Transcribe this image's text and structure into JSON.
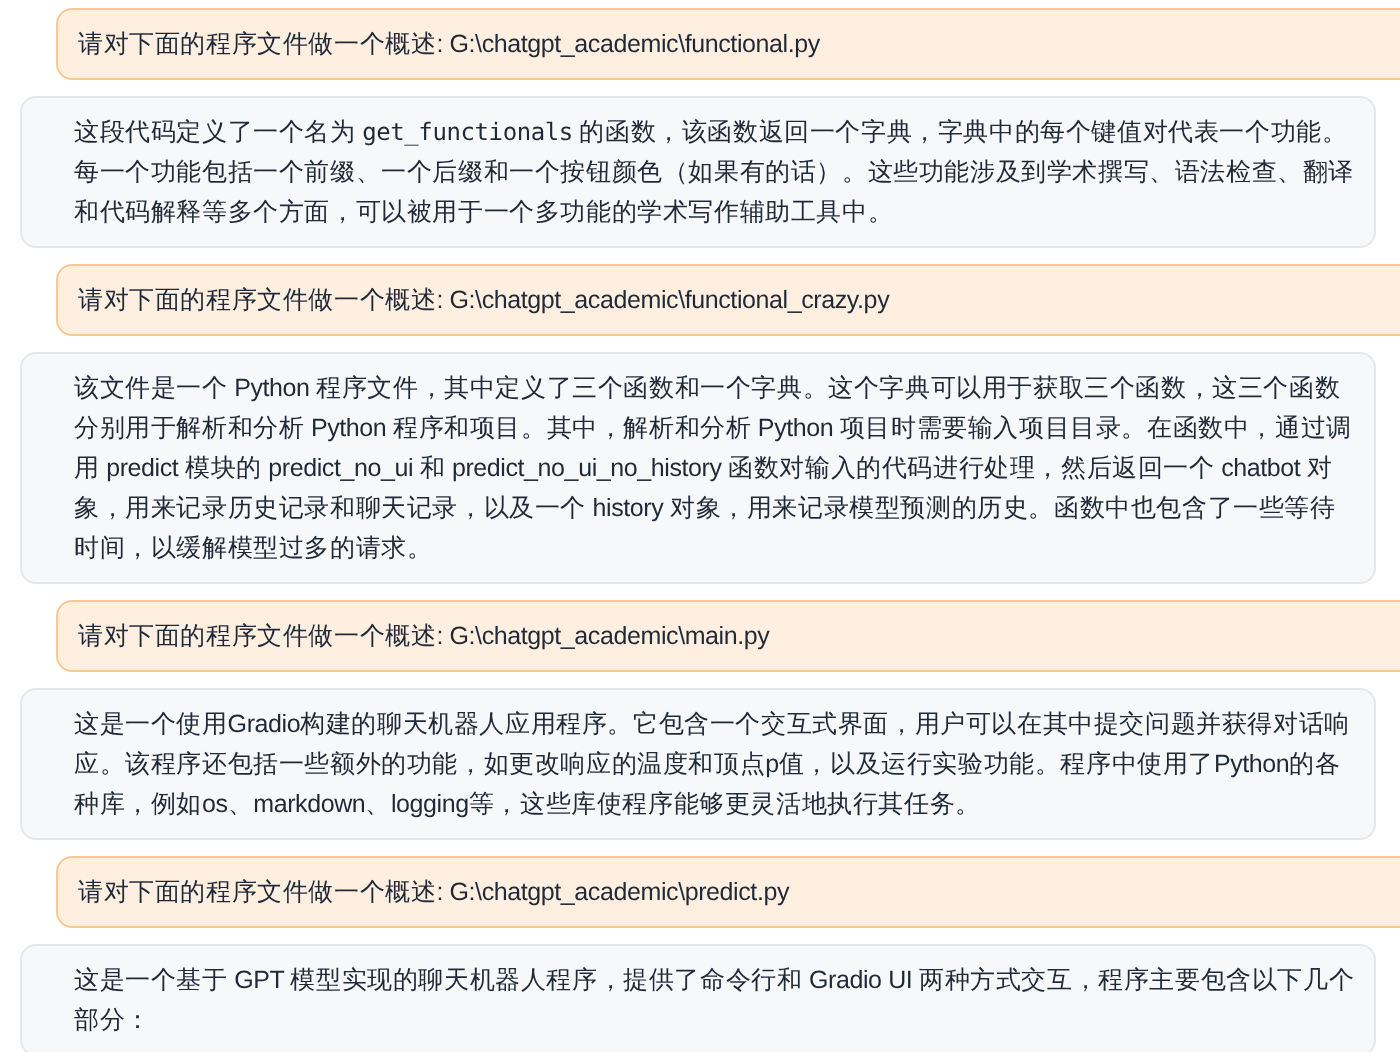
{
  "messages": [
    {
      "kind": "user",
      "segments": [
        {
          "kind": "text",
          "text": "请对下面的程序文件做一个概述: G:\\chatgpt_academic\\functional.py"
        }
      ]
    },
    {
      "kind": "bot",
      "segments": [
        {
          "kind": "text",
          "text": "这段代码定义了一个名为 "
        },
        {
          "kind": "code",
          "text": "get_functionals"
        },
        {
          "kind": "text",
          "text": " 的函数，该函数返回一个字典，字典中的每个键值对代表一个功能。每一个功能包括一个前缀、一个后缀和一个按钮颜色（如果有的话）。这些功能涉及到学术撰写、语法检查、翻译和代码解释等多个方面，可以被用于一个多功能的学术写作辅助工具中。"
        }
      ]
    },
    {
      "kind": "user",
      "segments": [
        {
          "kind": "text",
          "text": "请对下面的程序文件做一个概述: G:\\chatgpt_academic\\functional_crazy.py"
        }
      ]
    },
    {
      "kind": "bot",
      "segments": [
        {
          "kind": "text",
          "text": "该文件是一个 Python 程序文件，其中定义了三个函数和一个字典。这个字典可以用于获取三个函数，这三个函数分别用于解析和分析 Python 程序和项目。其中，解析和分析 Python 项目时需要输入项目目录。在函数中，通过调用 predict 模块的 predict_no_ui 和 predict_no_ui_no_history 函数对输入的代码进行处理，然后返回一个 chatbot 对象，用来记录历史记录和聊天记录，以及一个 history 对象，用来记录模型预测的历史。函数中也包含了一些等待时间，以缓解模型过多的请求。"
        }
      ]
    },
    {
      "kind": "user",
      "segments": [
        {
          "kind": "text",
          "text": "请对下面的程序文件做一个概述: G:\\chatgpt_academic\\main.py"
        }
      ]
    },
    {
      "kind": "bot",
      "segments": [
        {
          "kind": "text",
          "text": "这是一个使用Gradio构建的聊天机器人应用程序。它包含一个交互式界面，用户可以在其中提交问题并获得对话响应。该程序还包括一些额外的功能，如更改响应的温度和顶点p值，以及运行实验功能。程序中使用了Python的各种库，例如os、markdown、logging等，这些库使程序能够更灵活地执行其任务。"
        }
      ]
    },
    {
      "kind": "user",
      "segments": [
        {
          "kind": "text",
          "text": "请对下面的程序文件做一个概述: G:\\chatgpt_academic\\predict.py"
        }
      ]
    },
    {
      "kind": "bot",
      "segments": [
        {
          "kind": "text",
          "text": "这是一个基于 GPT 模型实现的聊天机器人程序，提供了命令行和 Gradio UI 两种方式交互，程序主要包含以下几个部分："
        }
      ]
    }
  ]
}
